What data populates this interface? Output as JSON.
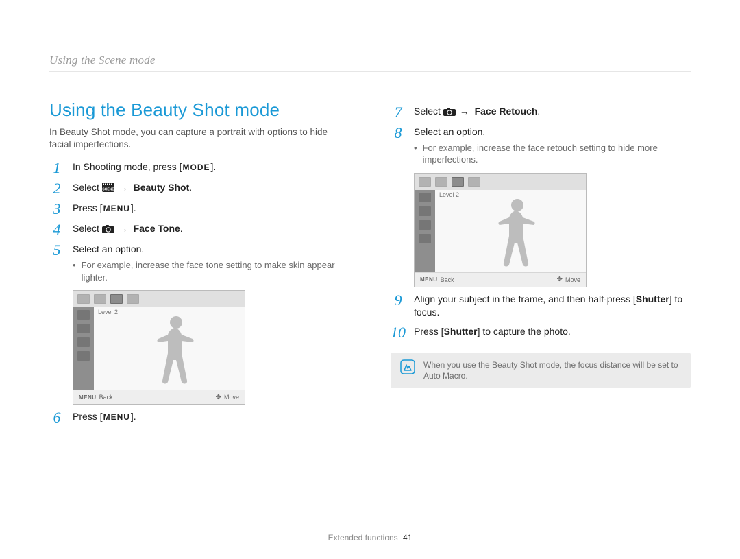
{
  "breadcrumb": "Using the Scene mode",
  "title": "Using the Beauty Shot mode",
  "intro": "In Beauty Shot mode, you can capture a portrait with options to hide facial imperfections.",
  "keys": {
    "mode": "MODE",
    "menu": "MENU"
  },
  "arrow": "→",
  "left_steps": {
    "s1_a": "In Shooting mode, press [",
    "s1_b": "].",
    "s2_a": "Select ",
    "s2_b": " Beauty Shot",
    "s2_c": ".",
    "s3_a": "Press [",
    "s3_b": "].",
    "s4_a": "Select ",
    "s4_b": " Face Tone",
    "s4_c": ".",
    "s5": "Select an option.",
    "s5_sub": "For example, increase the face tone setting to make skin appear lighter.",
    "s6_a": "Press [",
    "s6_b": "]."
  },
  "right_steps": {
    "s7_a": "Select ",
    "s7_b": " Face Retouch",
    "s7_c": ".",
    "s8": "Select an option.",
    "s8_sub": "For example, increase the face retouch setting to hide more imperfections.",
    "s9_a": "Align your subject in the frame, and then half-press [",
    "s9_b": "Shutter",
    "s9_c": "] to focus.",
    "s10_a": "Press [",
    "s10_b": "Shutter",
    "s10_c": "] to capture the photo."
  },
  "lcd": {
    "level": "Level 2",
    "back_key": "MENU",
    "back_label": "Back",
    "move_label": "Move"
  },
  "note": "When you use the Beauty Shot mode, the focus distance will be set to Auto Macro.",
  "footer_section": "Extended functions",
  "footer_page": "41",
  "nums": {
    "n1": "1",
    "n2": "2",
    "n3": "3",
    "n4": "4",
    "n5": "5",
    "n6": "6",
    "n7": "7",
    "n8": "8",
    "n9": "9",
    "n10": "10"
  }
}
